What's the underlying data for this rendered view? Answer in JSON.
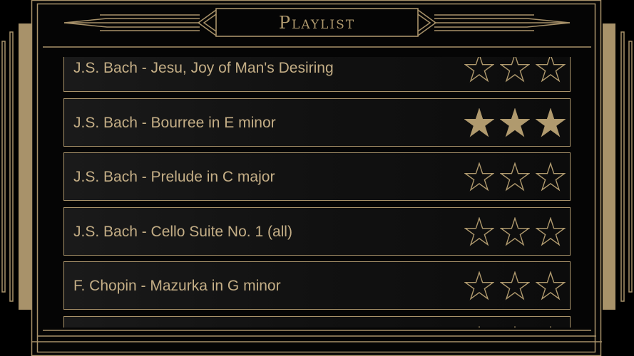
{
  "header": {
    "title": "Playlist"
  },
  "colors": {
    "gold": "#b09a6e",
    "text": "#c4ae86",
    "background": "#000000"
  },
  "tracks": [
    {
      "title": "J.S. Bach - Jesu, Joy of Man's Desiring",
      "rating": 0,
      "max_rating": 3
    },
    {
      "title": "J.S. Bach - Bourree in E minor",
      "rating": 3,
      "max_rating": 3
    },
    {
      "title": "J.S. Bach - Prelude in C major",
      "rating": 0,
      "max_rating": 3
    },
    {
      "title": "J.S. Bach - Cello Suite No. 1 (all)",
      "rating": 0,
      "max_rating": 3
    },
    {
      "title": "F. Chopin - Mazurka in G minor",
      "rating": 0,
      "max_rating": 3
    },
    {
      "title": "",
      "rating": 0,
      "max_rating": 3
    }
  ],
  "icons": {
    "rating": "star-icon"
  }
}
